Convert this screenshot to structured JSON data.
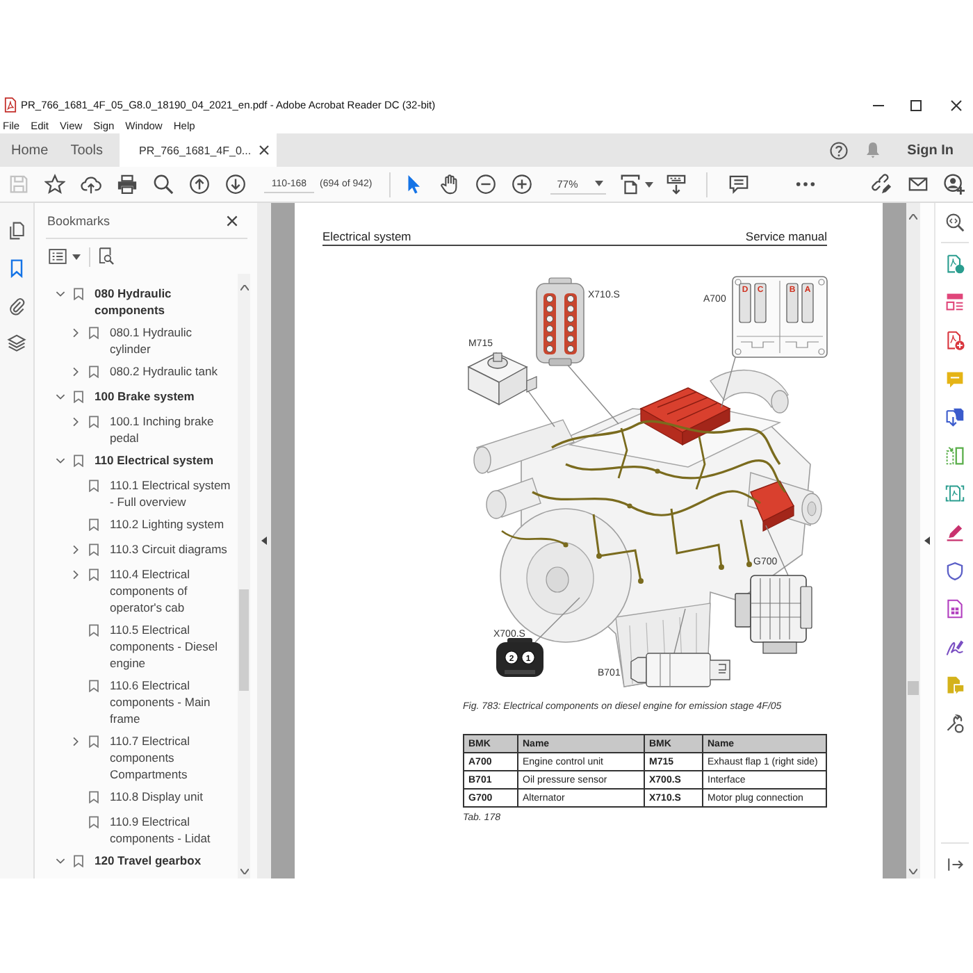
{
  "window": {
    "title": "PR_766_1681_4F_05_G8.0_18190_04_2021_en.pdf - Adobe Acrobat Reader DC (32-bit)"
  },
  "menu": [
    "File",
    "Edit",
    "View",
    "Sign",
    "Window",
    "Help"
  ],
  "tabs": [
    {
      "label": "Home",
      "selected": false,
      "closable": false
    },
    {
      "label": "Tools",
      "selected": false,
      "closable": false
    },
    {
      "label": "PR_766_1681_4F_0...",
      "selected": true,
      "closable": true
    }
  ],
  "account": {
    "sign_in": "Sign In"
  },
  "toolbar": {
    "save": {
      "disabled": true
    },
    "page_field": "110-168",
    "page_count": "(694 of 942)",
    "tools": [
      {
        "selected": true
      },
      {
        "selected": false
      }
    ],
    "zoom": "77%"
  },
  "side_rail": [
    {
      "selected": false
    },
    {
      "selected": true
    },
    {
      "selected": false
    },
    {
      "selected": false
    }
  ],
  "bookmarks": {
    "title": "Bookmarks",
    "items": [
      {
        "label": "080 Hydraulic components",
        "expanded": true,
        "children": [
          {
            "label": "080.1 Hydraulic cylinder",
            "expanded": false
          },
          {
            "label": "080.2 Hydraulic tank",
            "expanded": false
          }
        ]
      },
      {
        "label": "100 Brake system",
        "expanded": true,
        "children": [
          {
            "label": "100.1 Inching brake pedal",
            "expanded": false
          }
        ]
      },
      {
        "label": "110 Electrical system",
        "expanded": true,
        "children": [
          {
            "label": "110.1 Electrical system - Full overview"
          },
          {
            "label": "110.2 Lighting system"
          },
          {
            "label": "110.3 Circuit diagrams",
            "expanded": false
          },
          {
            "label": "110.4 Electrical components of operator's cab",
            "expanded": false
          },
          {
            "label": "110.5 Electrical components - Diesel engine"
          },
          {
            "label": "110.6 Electrical components - Main frame"
          },
          {
            "label": "110.7 Electrical components Compartments",
            "expanded": false
          },
          {
            "label": "110.8 Display unit"
          },
          {
            "label": "110.9 Electrical components - Lidat"
          }
        ]
      },
      {
        "label": "120 Travel gearbox",
        "expanded": true
      }
    ]
  },
  "document": {
    "header_left": "Electrical system",
    "header_right": "Service manual",
    "figure": {
      "callouts": [
        {
          "kind": "plug",
          "label": "X710.S"
        },
        {
          "kind": "control_unit",
          "label": "A700",
          "pins": [
            "D",
            "C",
            "B",
            "A"
          ]
        },
        {
          "kind": "actuator",
          "label": "M715"
        },
        {
          "kind": "alternator",
          "label": "G700"
        },
        {
          "kind": "round_plug",
          "label": "X700.S",
          "pins": [
            "2",
            "1"
          ]
        },
        {
          "kind": "sensor",
          "label": "B701"
        }
      ]
    },
    "caption": "Fig. 783: Electrical components on diesel engine for emission stage 4F/05",
    "table": {
      "columns": [
        "BMK",
        "Name",
        "BMK",
        "Name"
      ],
      "rows": [
        [
          "A700",
          "Engine control unit",
          "M715",
          "Exhaust flap 1 (right side)"
        ],
        [
          "B701",
          "Oil pressure sensor",
          "X700.S",
          "Interface"
        ],
        [
          "G700",
          "Alternator",
          "X710.S",
          "Motor plug connection"
        ]
      ]
    },
    "table_caption": "Tab. 178"
  }
}
